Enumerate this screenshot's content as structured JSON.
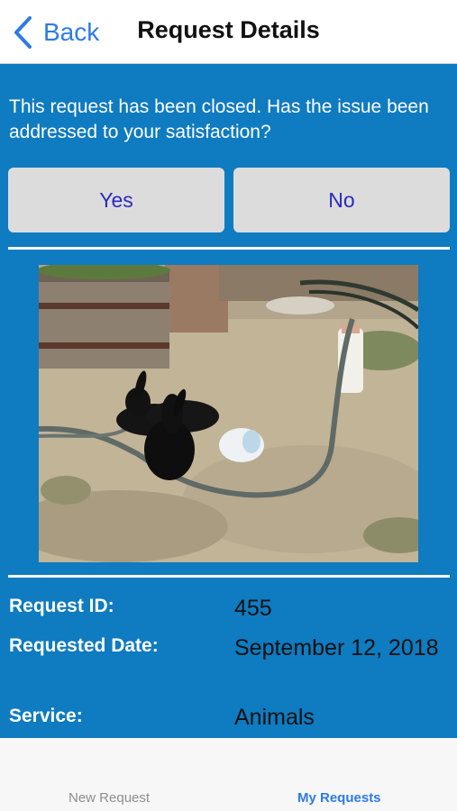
{
  "nav": {
    "back_label": "Back",
    "title": "Request Details"
  },
  "closed_prompt": {
    "message": "This request has been closed. Has the issue been addressed to your satisfaction?",
    "yes_label": "Yes",
    "no_label": "No"
  },
  "details": [
    {
      "label": "Request ID:",
      "value": "455"
    },
    {
      "label": "Requested Date:",
      "value": "September 12, 2018"
    },
    {
      "label": "Service:",
      "value": "Animals"
    }
  ],
  "tabs": [
    {
      "label": "New Request",
      "active": false
    },
    {
      "label": "My Requests",
      "active": true
    }
  ],
  "colors": {
    "accent": "#2d7be5",
    "content_background": "#0f7bc0",
    "button_background": "#dcdcdc",
    "button_text": "#2a2abf"
  },
  "icons": [
    "chevron-left-icon"
  ]
}
